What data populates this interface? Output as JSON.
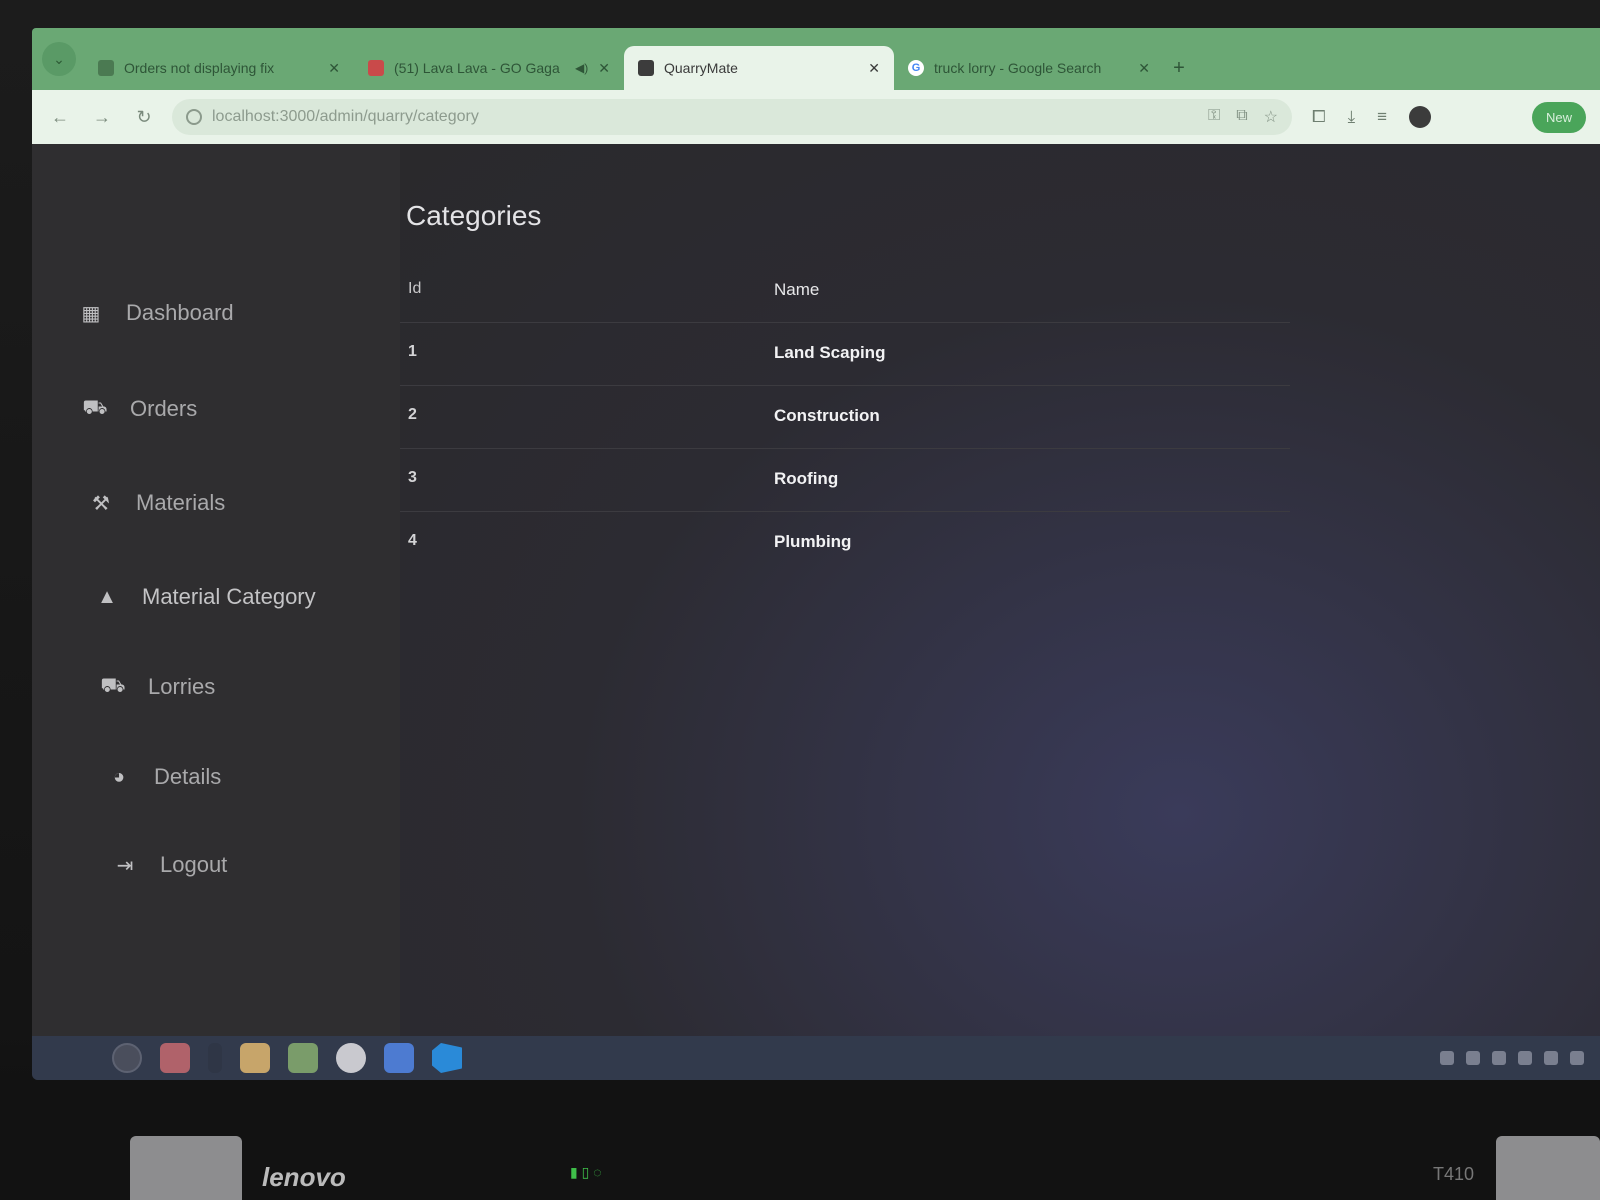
{
  "browser": {
    "tabs": [
      {
        "title": "Orders not displaying fix",
        "active": false,
        "favicon": "github-icon"
      },
      {
        "title": "(51) Lava Lava - GO Gaga",
        "active": false,
        "favicon": "youtube-icon",
        "audio": true
      },
      {
        "title": "QuarryMate",
        "active": true,
        "favicon": "app-icon"
      },
      {
        "title": "truck lorry - Google Search",
        "active": false,
        "favicon": "google-icon"
      }
    ],
    "new_tab_label": "+",
    "url": "localhost:3000/admin/quarry/category",
    "new_button": "New"
  },
  "sidebar": {
    "items": [
      {
        "label": "Dashboard",
        "icon": "dashboard-icon"
      },
      {
        "label": "Orders",
        "icon": "truck-icon"
      },
      {
        "label": "Materials",
        "icon": "tools-icon"
      },
      {
        "label": "Material Category",
        "icon": "shapes-icon"
      },
      {
        "label": "Lorries",
        "icon": "truck-icon"
      },
      {
        "label": "Details",
        "icon": "details-icon"
      },
      {
        "label": "Logout",
        "icon": "logout-icon"
      }
    ]
  },
  "main": {
    "title": "Categories",
    "table": {
      "columns": [
        "Id",
        "Name"
      ],
      "rows": [
        {
          "id": "1",
          "name": "Land Scaping"
        },
        {
          "id": "2",
          "name": "Construction"
        },
        {
          "id": "3",
          "name": "Roofing"
        },
        {
          "id": "4",
          "name": "Plumbing"
        }
      ]
    }
  },
  "laptop": {
    "brand": "lenovo",
    "model": "T410"
  }
}
